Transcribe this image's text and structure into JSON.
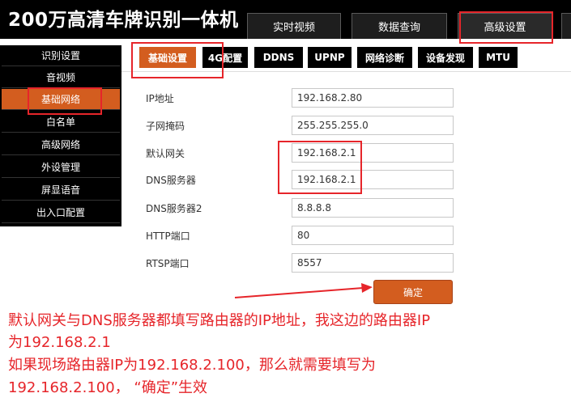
{
  "app_title": "200万高清车牌识别一体机",
  "top_nav": [
    "实时视频",
    "数据查询",
    "高级设置"
  ],
  "sidebar": [
    "识别设置",
    "音视频",
    "基础网络",
    "白名单",
    "高级网络",
    "外设管理",
    "屏显语音",
    "出入口配置"
  ],
  "sub_tabs": [
    "基础设置",
    "4G配置",
    "DDNS",
    "UPNP",
    "网络诊断",
    "设备发现",
    "MTU"
  ],
  "form": {
    "ip": {
      "label": "IP地址",
      "value": "192.168.2.80"
    },
    "mask": {
      "label": "子网掩码",
      "value": "255.255.255.0"
    },
    "gateway": {
      "label": "默认网关",
      "value": "192.168.2.1"
    },
    "dns": {
      "label": "DNS服务器",
      "value": "192.168.2.1"
    },
    "dns2": {
      "label": "DNS服务器2",
      "value": "8.8.8.8"
    },
    "http": {
      "label": "HTTP端口",
      "value": "80"
    },
    "rtsp": {
      "label": "RTSP端口",
      "value": "8557"
    },
    "confirm_label": "确定"
  },
  "annotation_lines": [
    "默认网关与DNS服务器都填写路由器的IP地址，我这边的路由器IP",
    "为192.168.2.1",
    "如果现场路由器IP为192.168.2.100，那么就需要填写为",
    "192.168.2.100，  “确定”生效"
  ],
  "colors": {
    "accent": "#d35d1f",
    "annotation": "#e6252a",
    "header": "#000000"
  }
}
